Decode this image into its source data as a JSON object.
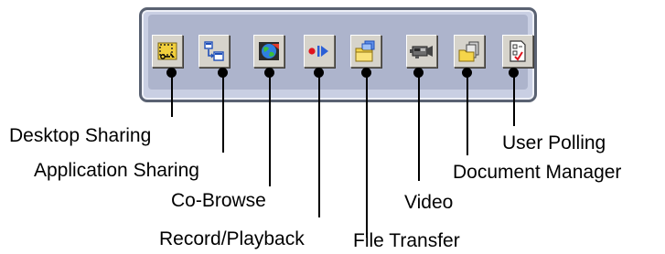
{
  "toolbar": {
    "buttons": [
      {
        "id": "desktop-sharing",
        "label": "Desktop Sharing",
        "icon": "desktop-sharing-icon"
      },
      {
        "id": "application-sharing",
        "label": "Application Sharing",
        "icon": "application-sharing-icon"
      },
      {
        "id": "co-browse",
        "label": "Co-Browse",
        "icon": "co-browse-icon"
      },
      {
        "id": "record-playback",
        "label": "Record/Playback",
        "icon": "record-playback-icon"
      },
      {
        "id": "file-transfer",
        "label": "File Transfer",
        "icon": "file-transfer-icon"
      },
      {
        "id": "video",
        "label": "Video",
        "icon": "video-camera-icon"
      },
      {
        "id": "document-manager",
        "label": "Document Manager",
        "icon": "document-manager-icon"
      },
      {
        "id": "user-polling",
        "label": "User Polling",
        "icon": "user-polling-icon"
      }
    ]
  },
  "colors": {
    "frame_border": "#5a6272",
    "frame_fill": "#c9cfe3",
    "button_face": "#d6d3cb",
    "record_red": "#e0141e",
    "play_blue": "#2a5fd6",
    "folder_yellow": "#f5d54a"
  }
}
